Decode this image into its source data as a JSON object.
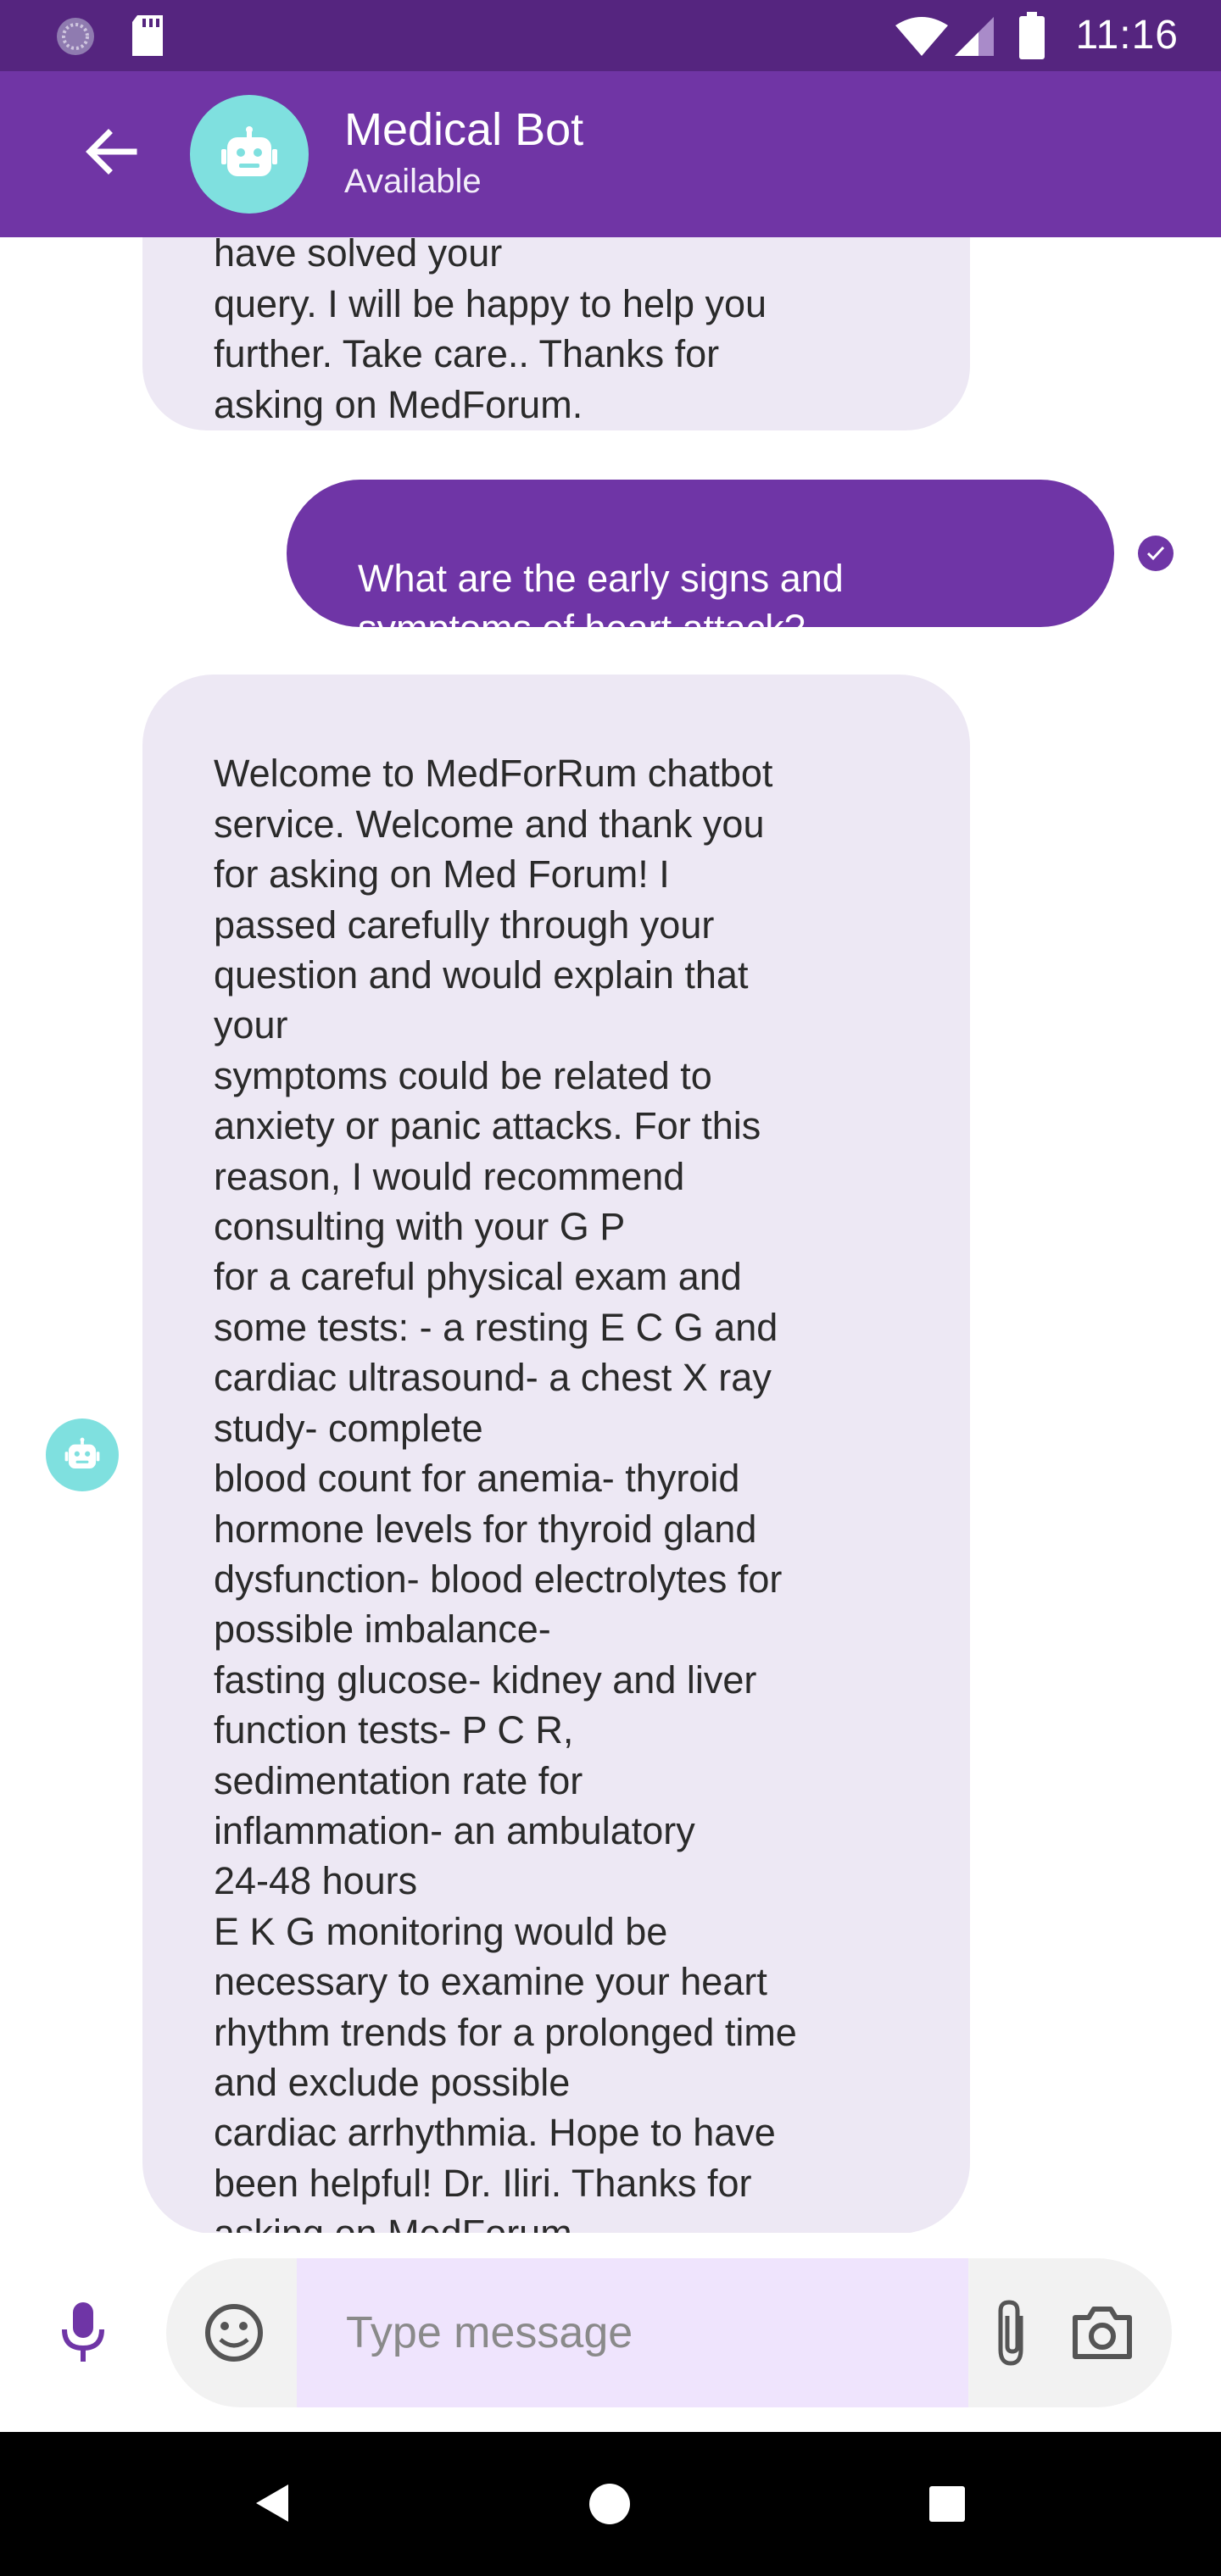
{
  "status_bar": {
    "time": "11:16",
    "icons": [
      "notification-circle-icon",
      "sd-card-icon",
      "wifi-icon",
      "cell-signal-icon",
      "battery-icon"
    ]
  },
  "app_bar": {
    "title": "Medical Bot",
    "subtitle": "Available",
    "back_icon": "arrow-left-icon",
    "avatar_icon": "robot-icon",
    "color": "#7035a5"
  },
  "messages": [
    {
      "sender": "bot",
      "text": "have solved your\nquery. I will be happy to help you\nfurther. Take care.. Thanks for\nasking on MedForum."
    },
    {
      "sender": "user",
      "text": "What are the early signs and\nsymptoms of heart attack?",
      "status_icon": "check-circle-icon"
    },
    {
      "sender": "bot",
      "avatar_icon": "robot-icon",
      "text": "Welcome to MedForRum chatbot\nservice. Welcome and thank you\nfor asking on  Med Forum! I\npassed carefully through your\nquestion and would explain that\nyour\nsymptoms could be related to\nanxiety or panic attacks.  For this\nreason,  I would recommend\nconsulting with your  G P\nfor a careful physical exam and\nsome tests: - a resting  E C G and\ncardiac ultrasound- a chest  X ray\nstudy- complete\nblood count for anemia- thyroid\nhormone levels for thyroid gland\ndysfunction- blood electrolytes for\npossible imbalance-\nfasting glucose- kidney and liver\nfunction tests-  P C R,\nsedimentation rate for\ninflammation- an ambulatory\n24-48 hours\nE K G monitoring would be\nnecessary to examine your heart\nrhythm trends for a prolonged time\nand exclude possible\ncardiac arrhythmia. Hope to have\nbeen helpful! Dr. Iliri. Thanks for\nasking on MedForum."
    }
  ],
  "input": {
    "placeholder": "Type message",
    "value": "",
    "icons": [
      "mic-icon",
      "emoji-icon",
      "paperclip-icon",
      "camera-icon"
    ]
  },
  "nav_bar": {
    "icons": [
      "nav-back-icon",
      "nav-home-icon",
      "nav-recents-icon"
    ]
  },
  "colors": {
    "status_bar": "#55257f",
    "brand": "#7035a5",
    "bot_bubble": "#ede8f4",
    "avatar": "#7fe0df",
    "input_field": "#efe4fd"
  }
}
